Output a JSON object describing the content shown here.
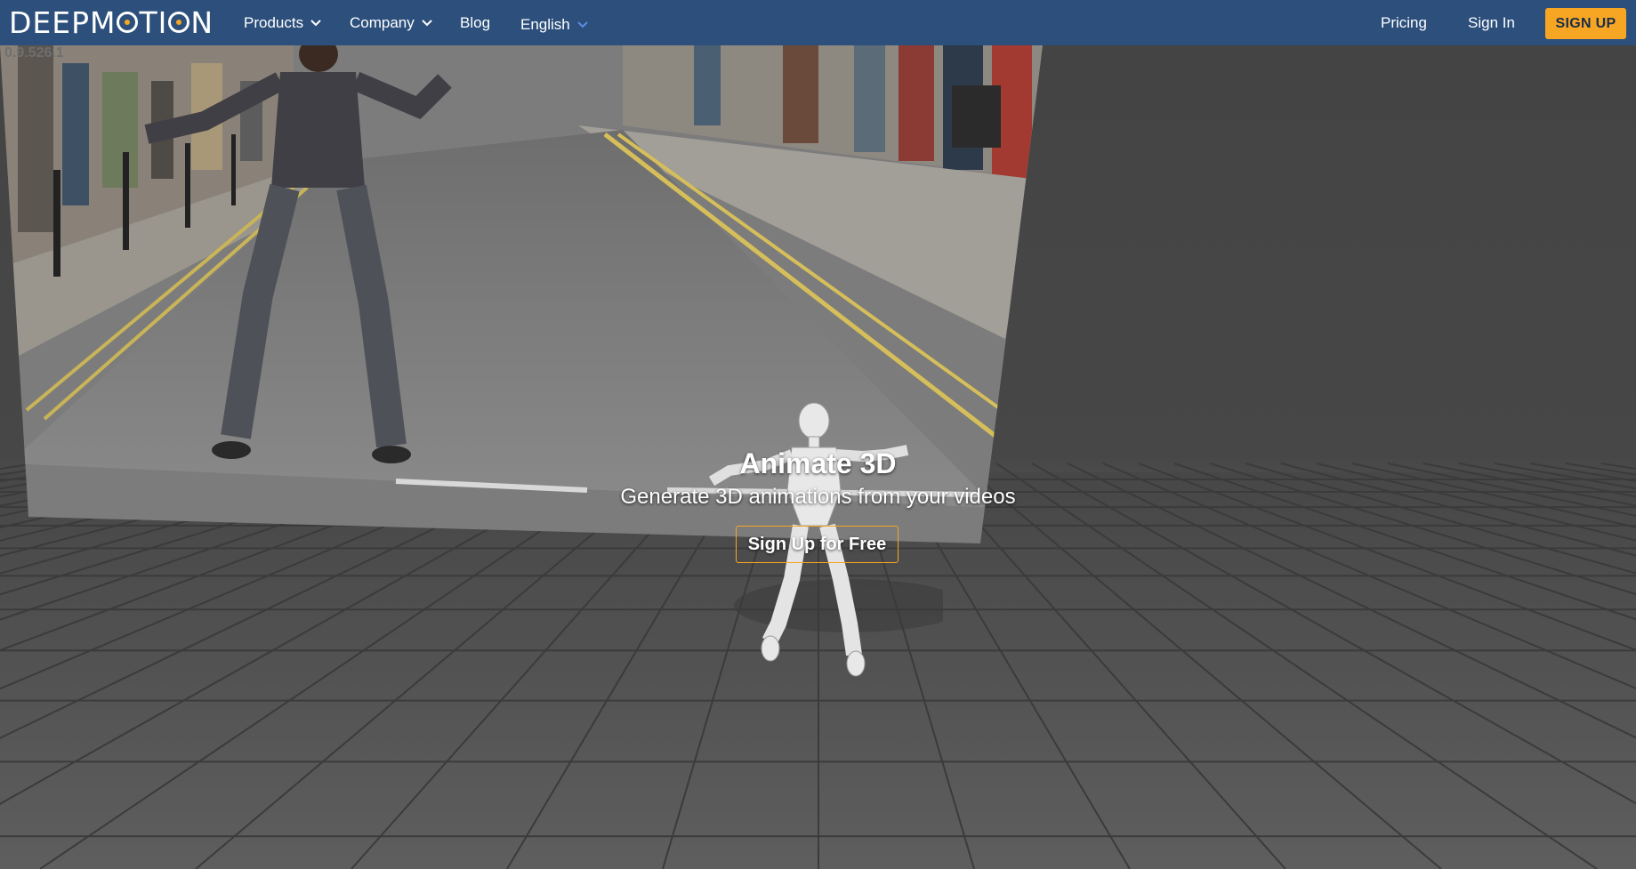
{
  "nav": {
    "logo_text_left": "DEEPM",
    "logo_text_right": "TI",
    "logo_text_end": "N",
    "products_label": "Products",
    "company_label": "Company",
    "blog_label": "Blog",
    "language_label": "English",
    "pricing_label": "Pricing",
    "signin_label": "Sign In",
    "signup_label": "SIGN UP"
  },
  "version": "0.9.526.1",
  "hero": {
    "title": "Animate 3D",
    "subtitle": "Generate 3D animations from your videos",
    "cta_label": "Sign Up for Free"
  },
  "colors": {
    "nav_bg": "#2c4f7c",
    "accent": "#f6a623",
    "scene_bg": "#474747"
  },
  "icons": {
    "products_chevron": "chevron-down-icon",
    "company_chevron": "chevron-down-icon",
    "language_chevron": "chevron-down-icon"
  }
}
